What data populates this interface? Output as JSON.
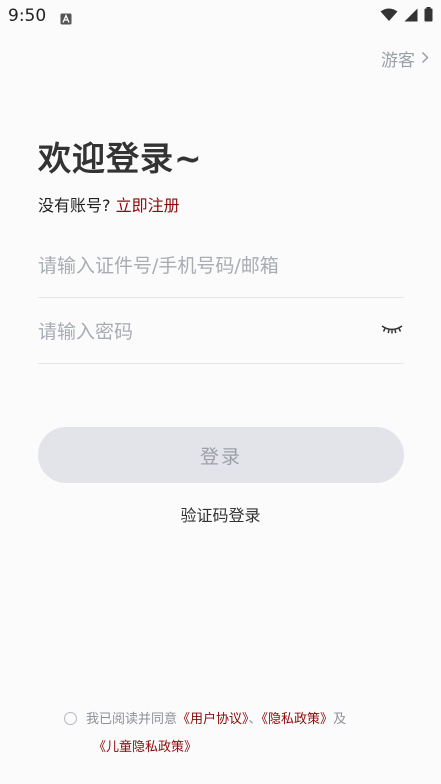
{
  "status_bar": {
    "time": "9:50"
  },
  "header": {
    "guest_label": "游客",
    "guest_chevron": "chevron-right-icon"
  },
  "welcome": {
    "title": "欢迎登录~",
    "no_account_text": "没有账号?",
    "signup_link": "立即注册"
  },
  "form": {
    "account_placeholder": "请输入证件号/手机号码/邮箱",
    "password_placeholder": "请输入密码",
    "password_toggle_icon": "eye-closed-icon",
    "login_button": "登录",
    "sms_login": "验证码登录"
  },
  "agreement": {
    "prefix": "我已阅读并同意",
    "user_agreement": "《用户协议》",
    "separator": "、",
    "privacy_policy": "《隐私政策》",
    "and": "及",
    "child_privacy_policy": "《儿童隐私政策》"
  },
  "colors": {
    "accent": "#8b0a0a",
    "button_bg": "#e3e3ea",
    "button_text": "#9da0a8",
    "placeholder": "#a8acb3"
  }
}
